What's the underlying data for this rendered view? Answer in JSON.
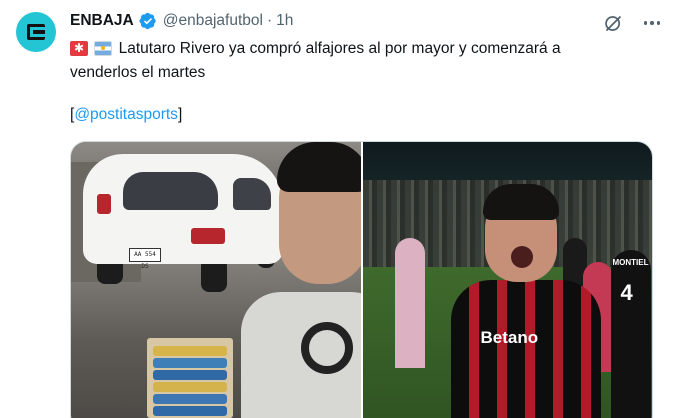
{
  "account": {
    "name": "ENBAJA",
    "handle": "@enbajafutbol",
    "separator": "·",
    "time": "1h",
    "avatar_icon": "enbaja-logo-icon",
    "avatar_color": "#23c4d4",
    "verified_icon": "verified-badge-icon",
    "verified_color": "#1d9bf0"
  },
  "actions": {
    "grok_icon": "grok-icon",
    "more_icon": "more-options-icon"
  },
  "tweet": {
    "flags": [
      "sos-flag-icon",
      "argentina-flag-icon"
    ],
    "text_line1": "Latutaro Rivero ya compró alfajores al por mayor y comenzará a",
    "text_line2": "venderlos el martes",
    "mention_open": "[",
    "mention": "@postitasports",
    "mention_close": "]",
    "mention_color": "#1d9bf0"
  },
  "media": {
    "left": {
      "plate_text": "AA 554 DS"
    },
    "right": {
      "jersey_text": "Betano",
      "jersey_number": "4",
      "jersey_name": "MONTIEL"
    }
  }
}
